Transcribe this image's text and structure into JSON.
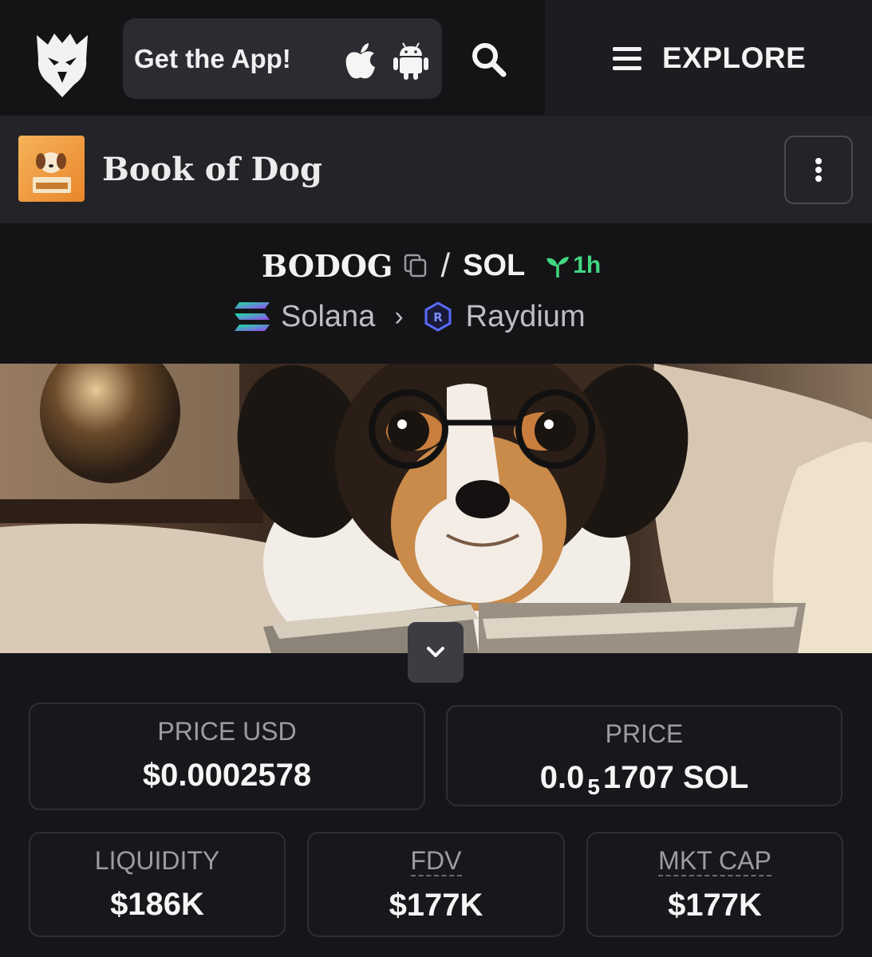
{
  "nav": {
    "app_label": "Get the App!",
    "explore_label": "EXPLORE",
    "icons": [
      "eagle-logo-icon",
      "apple-icon",
      "android-icon",
      "search-icon",
      "hamburger-icon"
    ]
  },
  "token": {
    "name": "Book of Dog",
    "avatar_text": "BODOG"
  },
  "pair": {
    "base": "BODOG",
    "separator": "/",
    "quote": "SOL",
    "age": "1h",
    "chain": "Solana",
    "dex": "Raydium",
    "chain_separator": "›"
  },
  "stats": {
    "price_usd": {
      "label": "PRICE USD",
      "value": "$0.0002578"
    },
    "price": {
      "label": "PRICE",
      "value_prefix": "0.0",
      "value_subscript": "5",
      "value_suffix": "1707 SOL"
    },
    "liquidity": {
      "label": "LIQUIDITY",
      "value": "$186K"
    },
    "fdv": {
      "label": "FDV",
      "value": "$177K"
    },
    "mkt_cap": {
      "label": "MKT CAP",
      "value": "$177K"
    }
  },
  "colors": {
    "background": "#16161a",
    "accent_green": "#42d680",
    "card_border": "#2e2e34",
    "muted_text": "#9c9ca3"
  }
}
